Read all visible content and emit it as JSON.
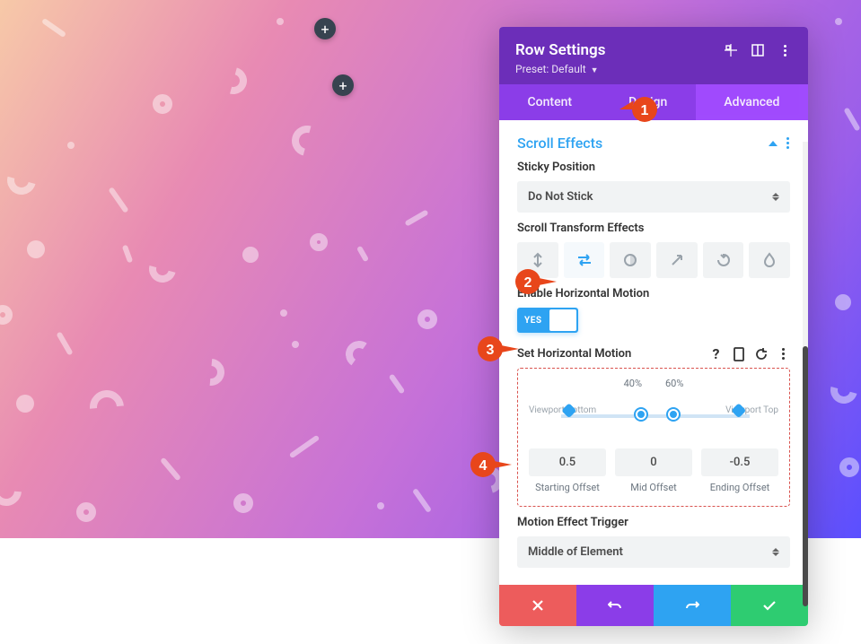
{
  "header": {
    "title": "Row Settings",
    "preset_label": "Preset:",
    "preset_value": "Default"
  },
  "tabs": {
    "content": "Content",
    "design": "Design",
    "advanced": "Advanced",
    "active": "advanced"
  },
  "scroll_effects": {
    "title": "Scroll Effects",
    "sticky_label": "Sticky Position",
    "sticky_value": "Do Not Stick",
    "scroll_transform_label": "Scroll Transform Effects",
    "enable_h_label": "Enable Horizontal Motion",
    "toggle_value": "YES",
    "set_h_label": "Set Horizontal Motion",
    "motion_top": {
      "left": "40%",
      "right": "60%"
    },
    "viewport_bottom": "Viewport Bottom",
    "viewport_top": "Viewport Top",
    "offsets": {
      "start_value": "0.5",
      "start_label": "Starting Offset",
      "mid_value": "0",
      "mid_label": "Mid Offset",
      "end_value": "-0.5",
      "end_label": "Ending Offset"
    },
    "motion_trigger_label": "Motion Effect Trigger",
    "motion_trigger_value": "Middle of Element"
  }
}
